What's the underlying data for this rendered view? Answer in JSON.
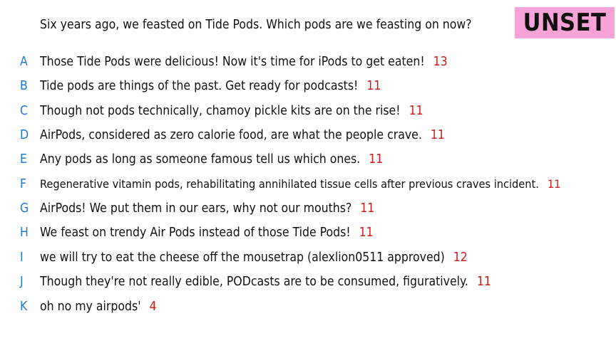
{
  "prompt": "Six years ago, we feasted on Tide Pods. Which pods are we feasting on now?",
  "badge": {
    "label": "UNSET",
    "color": "#f7a3d8"
  },
  "colors": {
    "letter": "#1f78d1",
    "score": "#d11a1a",
    "text": "#111111"
  },
  "entries": [
    {
      "letter": "A",
      "text": "Those Tide Pods were delicious! Now it's time for iPods to get eaten!",
      "score": "13"
    },
    {
      "letter": "B",
      "text": "Tide pods are things of the past. Get ready for podcasts!",
      "score": "11"
    },
    {
      "letter": "C",
      "text": "Though not pods technically, chamoy pickle kits are on the rise!",
      "score": "11"
    },
    {
      "letter": "D",
      "text": "AirPods, considered as zero calorie food, are what the people crave.",
      "score": "11"
    },
    {
      "letter": "E",
      "text": "Any pods as long as someone famous tell us which ones.",
      "score": "11"
    },
    {
      "letter": "F",
      "text": "Regenerative vitamin pods, rehabilitating annihilated tissue cells after previous craves incident.",
      "score": "11"
    },
    {
      "letter": "G",
      "text": "AirPods! We put them in our ears, why not our mouths?",
      "score": "11"
    },
    {
      "letter": "H",
      "text": "We feast on trendy Air Pods instead of those Tide Pods!",
      "score": "11"
    },
    {
      "letter": "I",
      "text": "we will try to eat the cheese off the mousetrap (alexlion0511 approved)",
      "score": "12"
    },
    {
      "letter": "J",
      "text": "Though they're not really edible, PODcasts are to be consumed, figuratively.",
      "score": "11"
    },
    {
      "letter": "K",
      "text": "oh no my airpods'",
      "score": "4"
    }
  ]
}
